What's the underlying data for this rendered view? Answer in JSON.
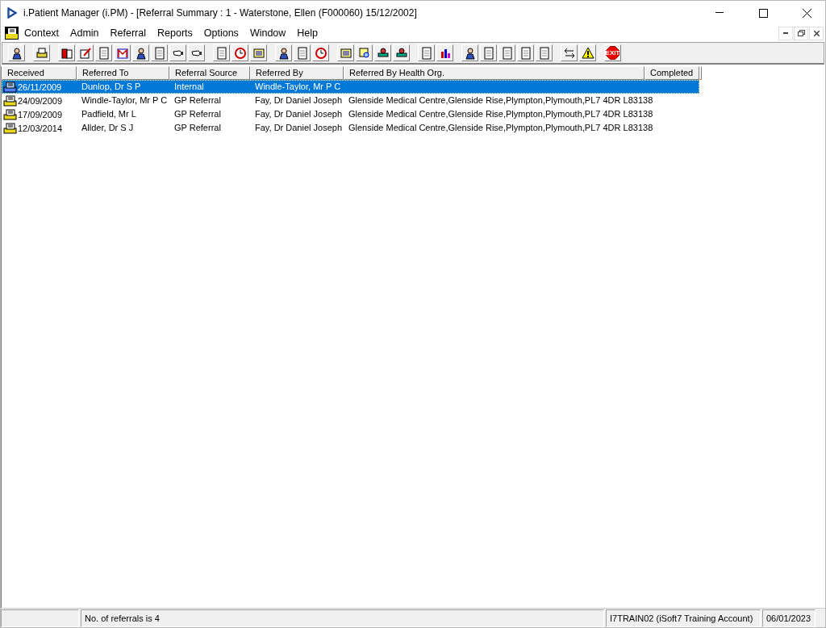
{
  "window": {
    "title": "i.Patient Manager (i.PM) - [Referral Summary : 1 - Waterstone, Ellen (F000060) 15/12/2002]"
  },
  "menu": [
    "Context",
    "Admin",
    "Referral",
    "Reports",
    "Options",
    "Window",
    "Help"
  ],
  "toolbar": {
    "exit_label": "EXIT"
  },
  "table": {
    "columns": [
      "Received",
      "Referred To",
      "Referral Source",
      "Referred By",
      "Referred By Health Org.",
      "Completed"
    ],
    "rows": [
      {
        "selected": true,
        "cells": [
          "26/11/2009",
          "Dunlop, Dr S P",
          "Internal",
          "Windle-Taylor, Mr P C",
          "",
          ""
        ]
      },
      {
        "selected": false,
        "cells": [
          "24/09/2009",
          "Windle-Taylor, Mr P C",
          "GP Referral",
          "Fay, Dr Daniel Joseph",
          "Glenside Medical Centre,Glenside Rise,Plympton,Plymouth,PL7 4DR L83138",
          ""
        ]
      },
      {
        "selected": false,
        "cells": [
          "17/09/2009",
          "Padfield, Mr L",
          "GP Referral",
          "Fay, Dr Daniel Joseph",
          "Glenside Medical Centre,Glenside Rise,Plympton,Plymouth,PL7 4DR L83138",
          ""
        ]
      },
      {
        "selected": false,
        "cells": [
          "12/03/2014",
          "Allder, Dr S J",
          "GP Referral",
          "Fay, Dr Daniel Joseph",
          "Glenside Medical Centre,Glenside Rise,Plympton,Plymouth,PL7 4DR L83138",
          ""
        ]
      }
    ]
  },
  "status_bar": {
    "message": "No. of referrals is 4",
    "user": "I7TRAIN02 (iSoft7 Training Account)",
    "date": "06/01/2023"
  }
}
